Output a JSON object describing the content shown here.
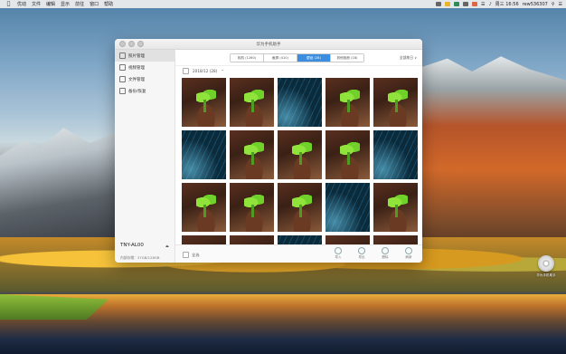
{
  "menubar": {
    "app": "优动",
    "items": [
      "文件",
      "编辑",
      "显示",
      "前往",
      "窗口",
      "帮助"
    ],
    "time": "周三 16:56",
    "user": "rew536307"
  },
  "window": {
    "title": "华为手机助手",
    "sidebar": {
      "items": [
        {
          "label": "照片管理",
          "icon": "photo-icon",
          "active": true
        },
        {
          "label": "视频管理",
          "icon": "video-icon",
          "active": false
        },
        {
          "label": "文件管理",
          "icon": "folder-icon",
          "active": false
        },
        {
          "label": "备份/恢复",
          "icon": "backup-icon",
          "active": false
        }
      ],
      "device_name": "TNY-AL00",
      "storage_text": "内部存储：",
      "storage_value": "37GB/128GB"
    },
    "tabs": [
      {
        "label": "相机 (1260)",
        "active": false
      },
      {
        "label": "截屏 (410)",
        "active": false
      },
      {
        "label": "壁纸 (28)",
        "active": true
      },
      {
        "label": "其他相册 (18)",
        "active": false
      }
    ],
    "sort_label": "全部按日 ∨",
    "date_group": "2018/12 (28)",
    "grid_photos": [
      "plant",
      "plant",
      "lines",
      "plant",
      "plant",
      "lines",
      "plant",
      "plant",
      "plant",
      "lines",
      "plant",
      "plant",
      "plant",
      "lines",
      "plant",
      "plant",
      "plant",
      "lines",
      "plant",
      "plant"
    ],
    "bottom": {
      "select_all": "全选",
      "actions": [
        "导入",
        "导出",
        "删除",
        "刷新"
      ]
    }
  },
  "desktop_icon_label": "华为手机助手"
}
